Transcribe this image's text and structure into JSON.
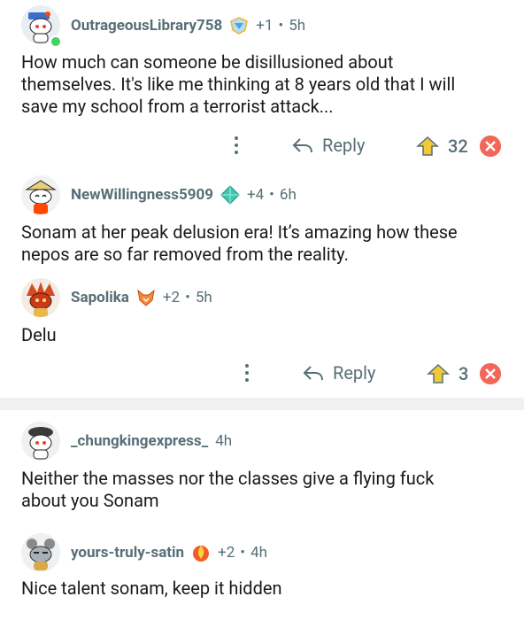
{
  "comments": [
    {
      "username": "OutrageousLibrary758",
      "award_icon": "diamond-award-icon",
      "plus": "+1",
      "dot": "•",
      "time": "5h",
      "body": "How much can someone be disillusioned about\nthemselves. It's like me thinking at 8 years old that I will\nsave my school from a terrorist attack...",
      "reply_label": "Reply",
      "score": "32"
    },
    {
      "username": "NewWillingness5909",
      "award_icon": "gem-award-icon",
      "plus": "+4",
      "dot": "•",
      "time": "6h",
      "body": "Sonam at her peak delusion era! It’s amazing how these\nnepos are so far removed from the reality."
    },
    {
      "username": "Sapolika",
      "award_icon": "fox-award-icon",
      "plus": "+2",
      "dot": "•",
      "time": "5h",
      "body": "Delu",
      "reply_label": "Reply",
      "score": "3"
    },
    {
      "username": "_chungkingexpress_",
      "time": "4h",
      "body": "Neither the masses nor the classes give a flying fuck\nabout you Sonam"
    },
    {
      "username": "yours-truly-satin",
      "award_icon": "flame-award-icon",
      "plus": "+2",
      "dot": "•",
      "time": "4h",
      "body": "Nice talent sonam, keep it hidden"
    }
  ],
  "colors": {
    "meta": "#576f76",
    "text": "#1a1a1b",
    "downvote": "#f26757",
    "upvote": "#f0c93b",
    "online": "#46d160",
    "divider": "#eef0f2"
  }
}
